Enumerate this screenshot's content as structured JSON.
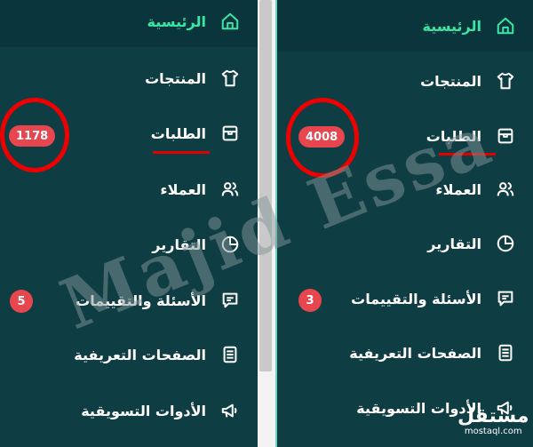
{
  "nav": [
    {
      "label": "الرئيسية",
      "icon": "home-icon",
      "active": true
    },
    {
      "label": "المنتجات",
      "icon": "tshirt-icon",
      "active": false
    },
    {
      "label": "الطلبات",
      "icon": "box-icon",
      "active": false
    },
    {
      "label": "العملاء",
      "icon": "users-icon",
      "active": false
    },
    {
      "label": "التقارير",
      "icon": "pie-chart-icon",
      "active": false
    },
    {
      "label": "الأسئلة والتقييمات",
      "icon": "message-icon",
      "active": false
    },
    {
      "label": "الصفحات التعريفية",
      "icon": "document-icon",
      "active": false
    },
    {
      "label": "الأدوات التسويقية",
      "icon": "megaphone-icon",
      "active": false
    }
  ],
  "left_panel": {
    "orders_badge": "1178",
    "questions_badge": "5"
  },
  "right_panel": {
    "orders_badge": "4008",
    "questions_badge": "3"
  },
  "watermark": "Majid Essa",
  "brand": {
    "arabic": "مستقل",
    "latin": "mostaql.com"
  },
  "colors": {
    "background": "#0f3d44",
    "active_text": "#39e6a3",
    "badge": "#e8464e",
    "annotation": "#ee0000"
  }
}
